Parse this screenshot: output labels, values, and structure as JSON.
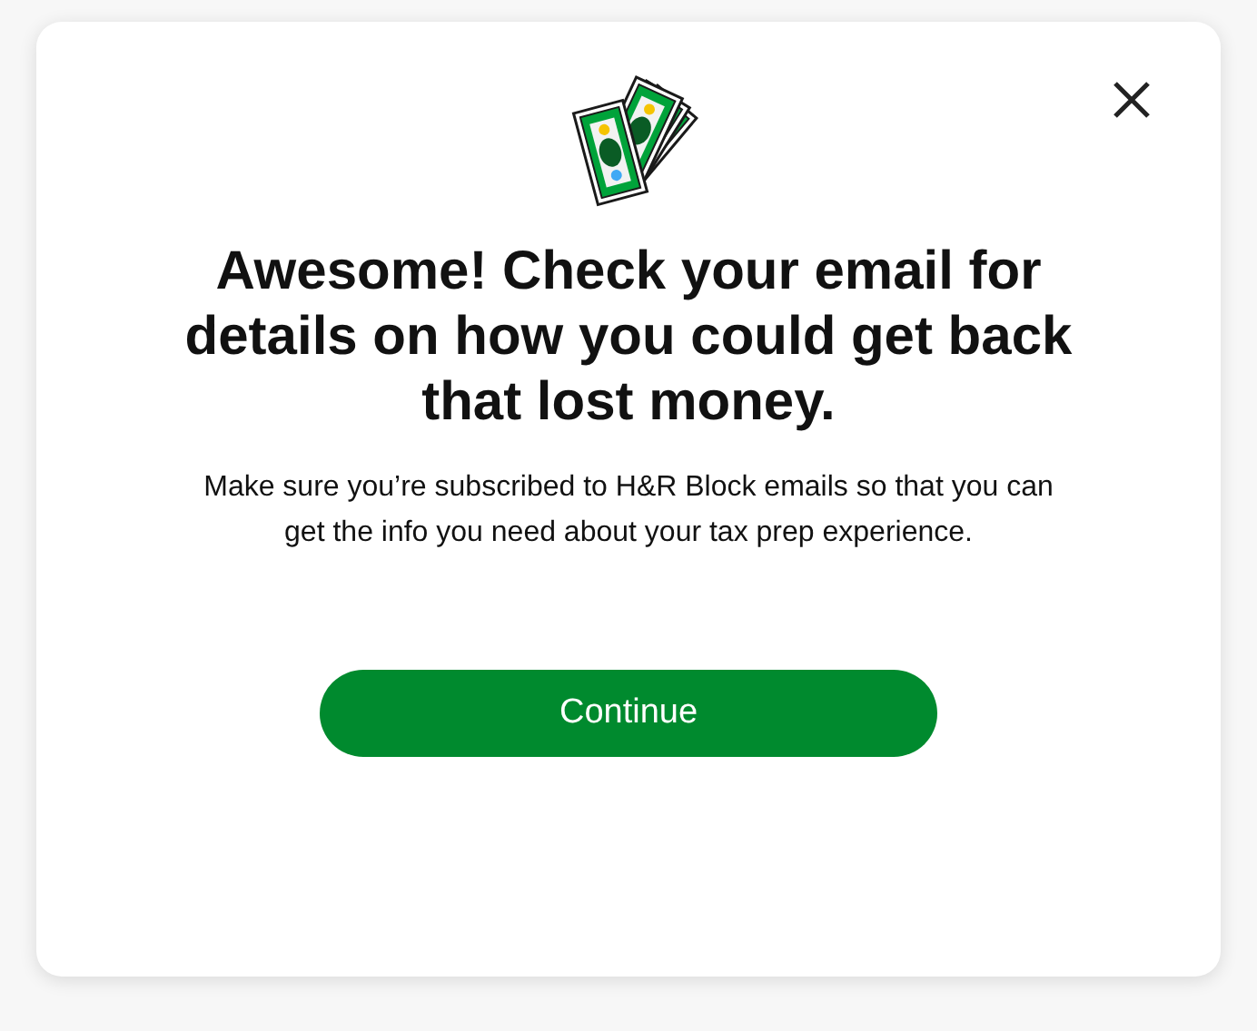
{
  "dialog": {
    "title": "Awesome! Check your email for details on how you could get back that lost money.",
    "message": "Make sure you’re subscribed to H&R Block emails so that you can get the info you need about your tax prep experience.",
    "button": "Continue"
  }
}
